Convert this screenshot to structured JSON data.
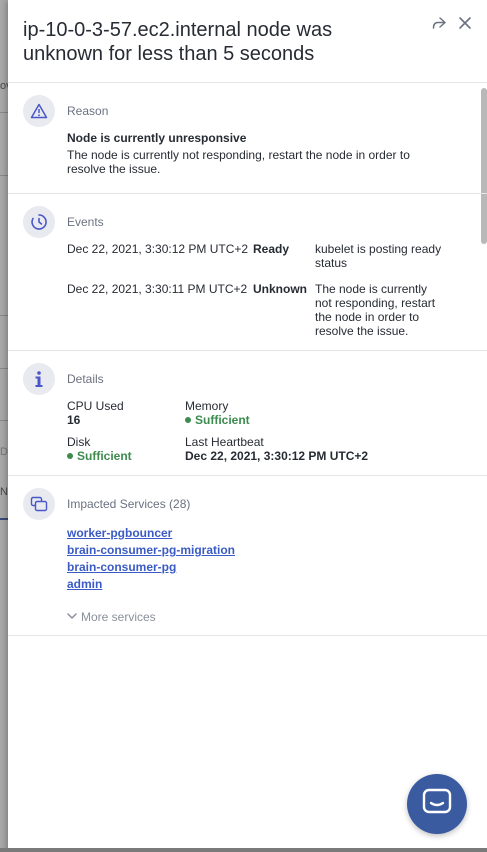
{
  "panel": {
    "title": "ip-10-0-3-57.ec2.internal node was unknown for less than 5 seconds"
  },
  "background": {
    "fragment_ow": "ov",
    "fragment_d": "D",
    "fragment_n": "N"
  },
  "reason": {
    "heading": "Reason",
    "title": "Node is currently unresponsive",
    "description": "The node is currently not responding, restart the node in order to resolve the issue."
  },
  "events": {
    "heading": "Events",
    "items": [
      {
        "time": "Dec 22, 2021, 3:30:12 PM UTC+2",
        "status": "Ready",
        "message": "kubelet is posting ready status"
      },
      {
        "time": "Dec 22, 2021, 3:30:11 PM UTC+2",
        "status": "Unknown",
        "message": "The node is currently not responding, restart the node in order to resolve the issue."
      }
    ]
  },
  "details": {
    "heading": "Details",
    "cpu_label": "CPU Used",
    "cpu_value": "16",
    "memory_label": "Memory",
    "memory_value": "Sufficient",
    "disk_label": "Disk",
    "disk_value": "Sufficient",
    "heartbeat_label": "Last Heartbeat",
    "heartbeat_value": "Dec 22, 2021, 3:30:12 PM UTC+2"
  },
  "impacted": {
    "heading": "Impacted Services (28)",
    "services": [
      "worker-pgbouncer",
      "brain-consumer-pg-migration",
      "brain-consumer-pg",
      "admin"
    ],
    "more_label": "More services"
  },
  "icons": {
    "share": "share-icon",
    "close": "close-icon",
    "reason": "warning-icon",
    "events": "timer-icon",
    "details": "info-icon",
    "impacted": "services-icon",
    "chat": "chat-icon"
  },
  "colors": {
    "accent": "#3b5bc4",
    "success": "#3d8b4f",
    "chat_button": "#3b5ba0"
  }
}
